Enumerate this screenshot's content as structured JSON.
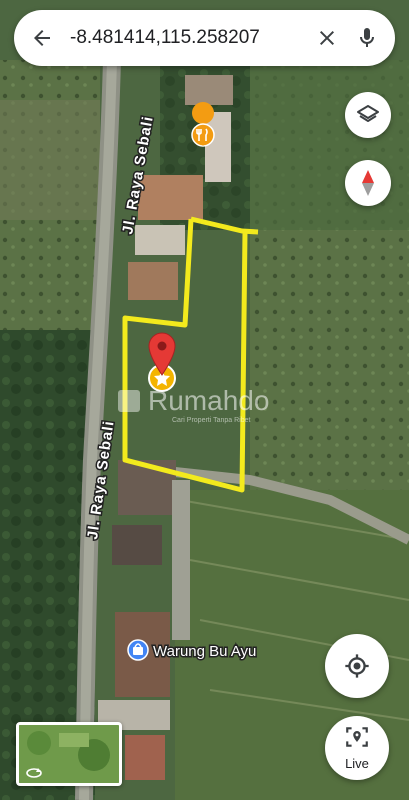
{
  "search": {
    "query": "-8.481414,115.258207"
  },
  "map": {
    "roads": [
      {
        "label": "Jl. Raya Sebali"
      },
      {
        "label": "Jl. Raya Sebali"
      }
    ],
    "poi": {
      "label": "Warung Bu Ayu"
    },
    "watermark": {
      "brand": "Rumahdo",
      "tagline": "Cari Properti Tanpa Ribet"
    },
    "boundary_color": "#f3ea1d",
    "pin_color": "#e53935"
  },
  "controls": {
    "live_label": "Live"
  },
  "icons": [
    "back-arrow-icon",
    "clear-icon",
    "microphone-icon",
    "layers-icon",
    "compass-icon",
    "restaurant-icon",
    "my-location-icon",
    "live-view-icon",
    "rotate-icon",
    "shopping-bag-icon",
    "location-pin-icon",
    "star-icon"
  ]
}
